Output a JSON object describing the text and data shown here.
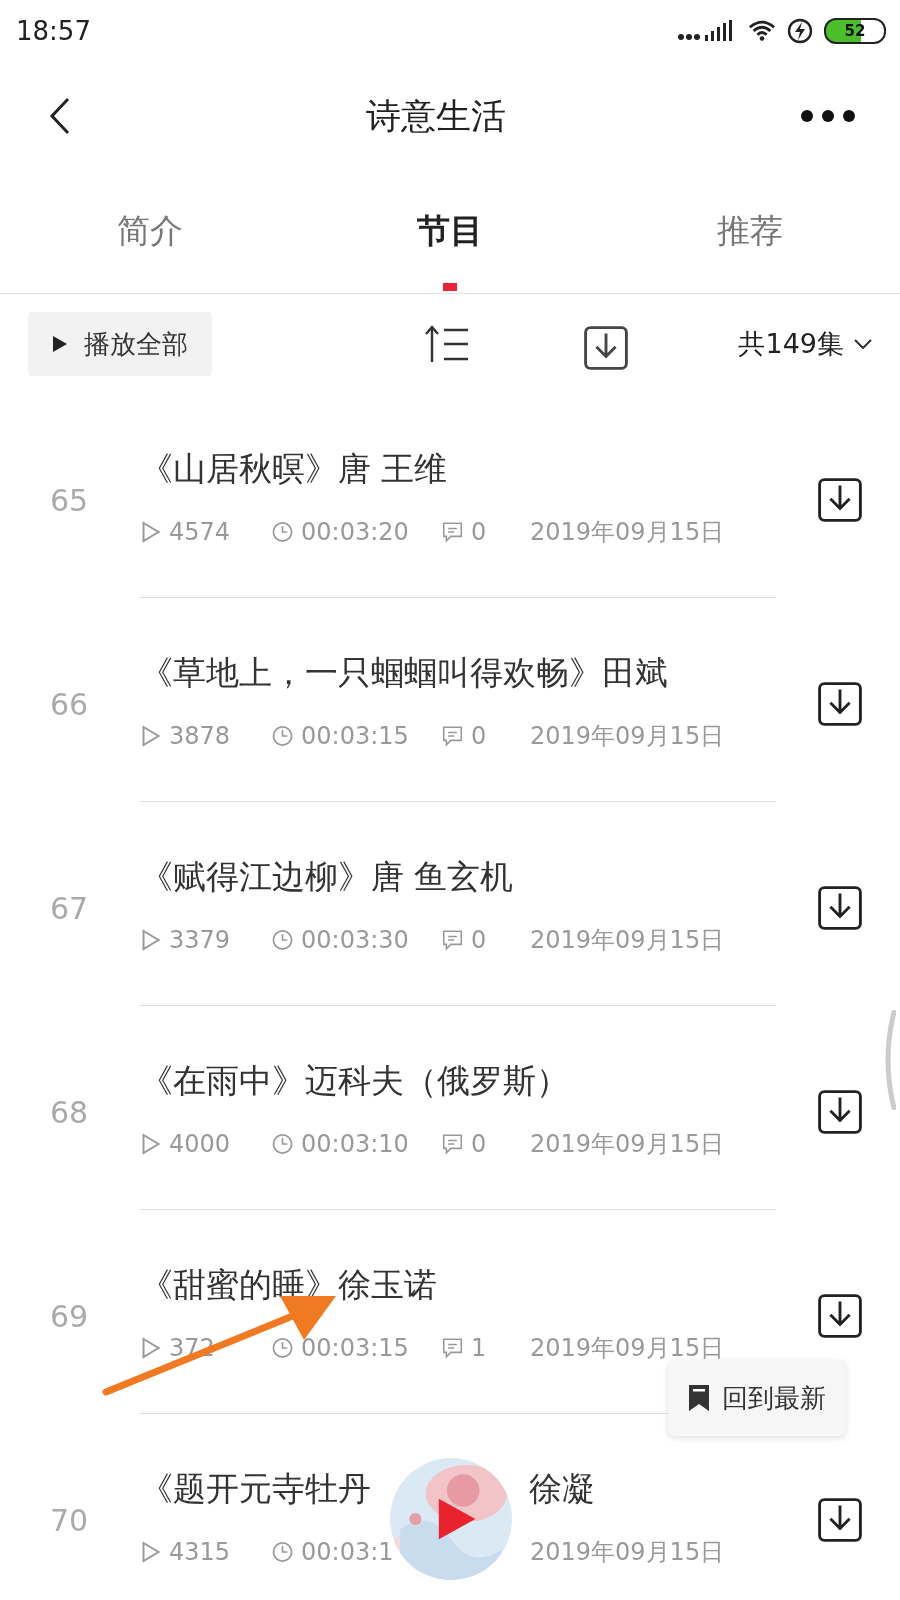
{
  "status_bar": {
    "time": "18:57",
    "battery": "52"
  },
  "header": {
    "title": "诗意生活"
  },
  "tabs": [
    {
      "label": "简介",
      "selected": false
    },
    {
      "label": "节目",
      "selected": true
    },
    {
      "label": "推荐",
      "selected": false
    }
  ],
  "toolbar": {
    "play_all": "播放全部",
    "episode_count": "共149集"
  },
  "episodes": [
    {
      "number": "65",
      "title": "《山居秋暝》唐 王维",
      "plays": "4574",
      "duration": "00:03:20",
      "comments": "0",
      "date": "2019年09月15日"
    },
    {
      "number": "66",
      "title": "《草地上，一只蝈蝈叫得欢畅》田斌",
      "plays": "3878",
      "duration": "00:03:15",
      "comments": "0",
      "date": "2019年09月15日"
    },
    {
      "number": "67",
      "title": "《赋得江边柳》唐 鱼玄机",
      "plays": "3379",
      "duration": "00:03:30",
      "comments": "0",
      "date": "2019年09月15日"
    },
    {
      "number": "68",
      "title": "《在雨中》迈科夫（俄罗斯）",
      "plays": "4000",
      "duration": "00:03:10",
      "comments": "0",
      "date": "2019年09月15日"
    },
    {
      "number": "69",
      "title": "《甜蜜的睡》徐玉诺",
      "plays": "372",
      "duration": "00:03:15",
      "comments": "1",
      "date": "2019年09月15日"
    },
    {
      "number": "70",
      "title": "《题开元寺牡丹",
      "title_tail": "徐凝",
      "plays": "4315",
      "duration": "00:03:1",
      "date": "2019年09月15日"
    }
  ],
  "back_to_latest": "回到最新"
}
